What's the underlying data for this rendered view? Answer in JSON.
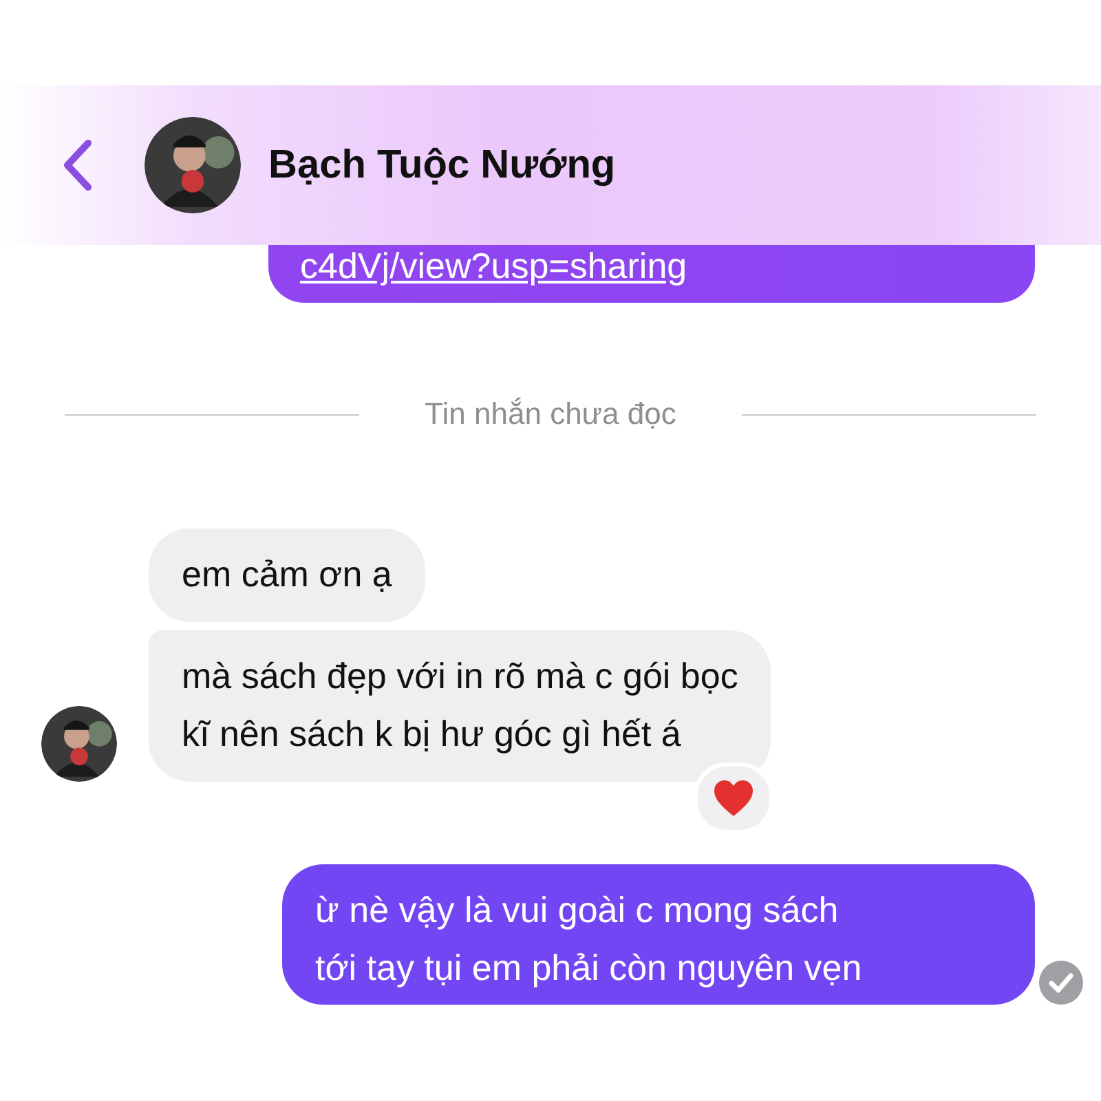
{
  "header": {
    "contact_name": "Bạch Tuộc Nướng"
  },
  "messages": [
    {
      "kind": "link",
      "text": "c4dVj/view?usp=sharing"
    },
    {
      "kind": "divider",
      "text": "Tin nhắn chưa đọc"
    },
    {
      "kind": "text",
      "outgoing": false,
      "text": "em cảm ơn ạ",
      "avatar": false,
      "reacted": false
    },
    {
      "kind": "text",
      "outgoing": false,
      "text": "mà sách đẹp với in rõ mà c gói bọc\nkĩ nên sách k bị hư góc gì hết á",
      "avatar": true,
      "reacted": true
    },
    {
      "kind": "text",
      "outgoing": true,
      "text": "ừ nè vậy là vui goài c mong sách\ntới tay tụi em phải còn nguyên vẹn",
      "seen": true
    }
  ]
}
